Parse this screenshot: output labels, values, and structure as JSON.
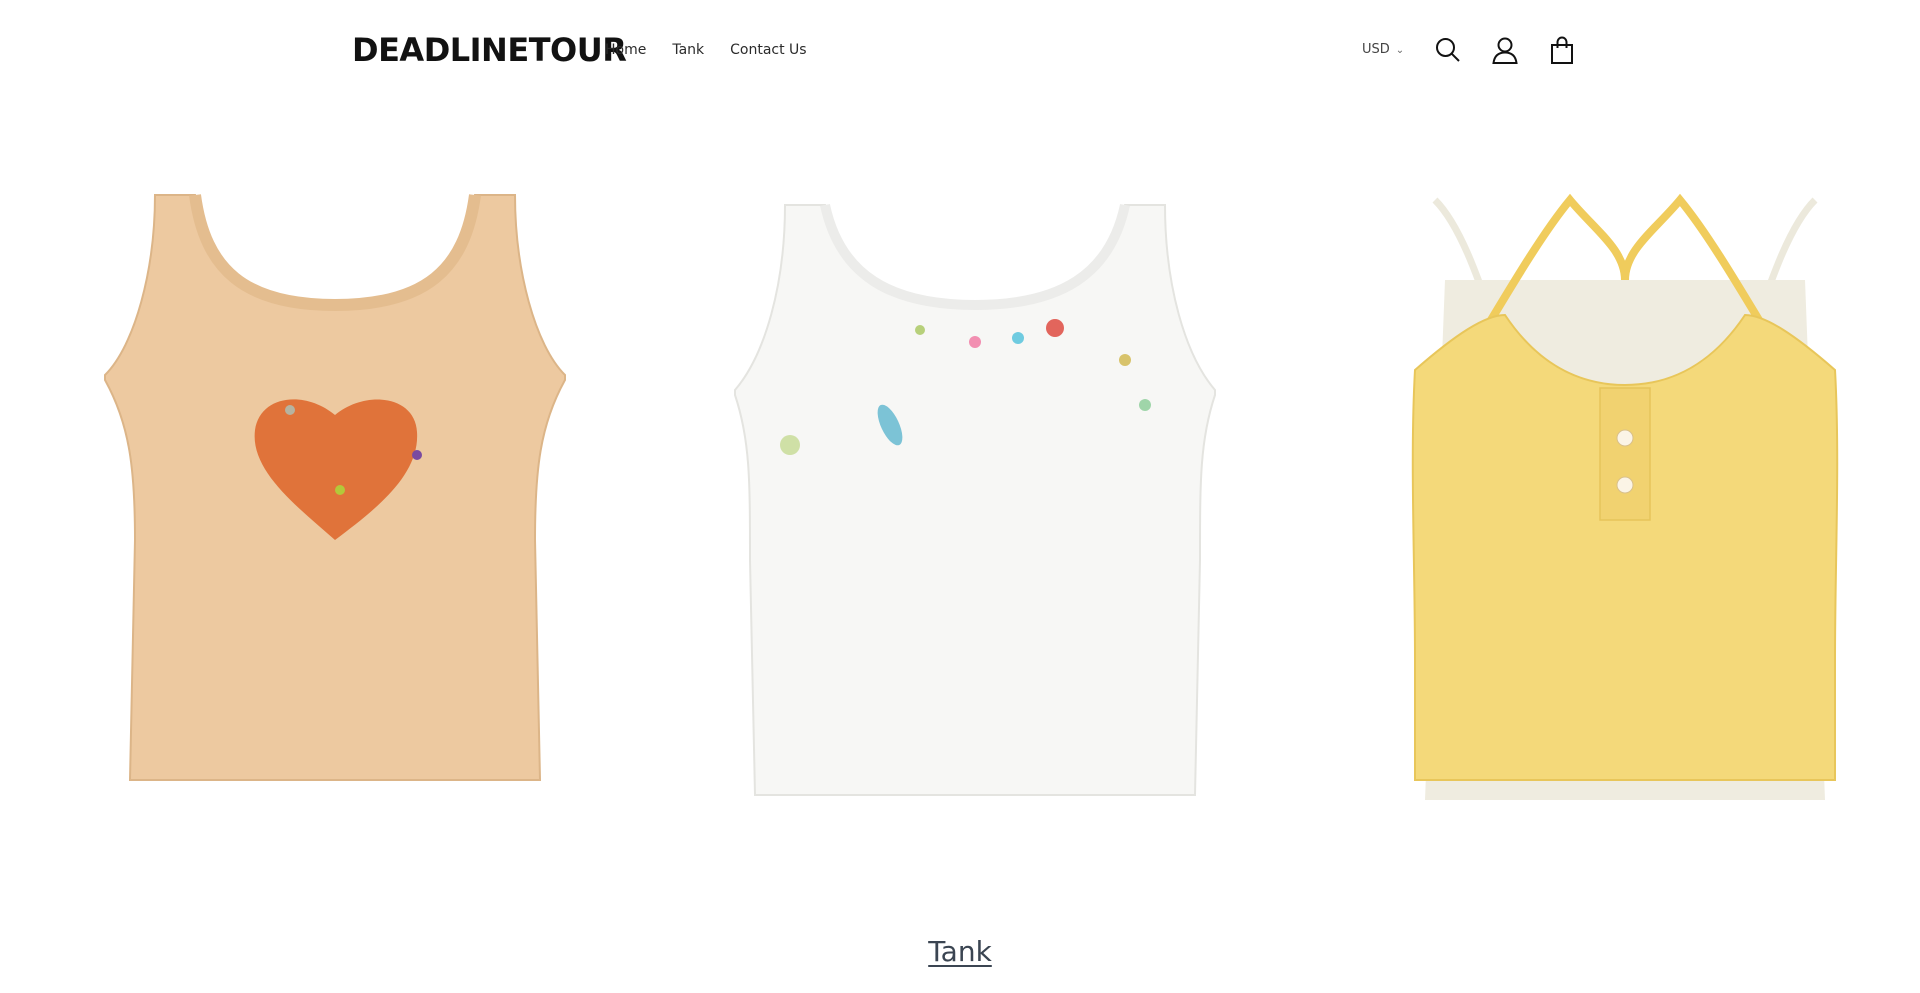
{
  "header": {
    "logo": "DEADLINETOUR",
    "nav": [
      {
        "label": "Home"
      },
      {
        "label": "Tank"
      },
      {
        "label": "Contact Us"
      }
    ],
    "currency": "USD",
    "icons": [
      "search-icon",
      "account-icon",
      "cart-icon"
    ]
  },
  "gallery": {
    "products": [
      {
        "image": "beige knit tank with orange heart",
        "color": "#edc9a0",
        "accent": "#e0733a"
      },
      {
        "image": "white tank with embroidered charms",
        "color": "#f6f6f4",
        "accent": "#7cc3d6"
      },
      {
        "image": "yellow halter cami layered over white",
        "color": "#f4d97a",
        "accent": "#ece9dc"
      }
    ]
  },
  "collection": {
    "title": "Tank"
  }
}
